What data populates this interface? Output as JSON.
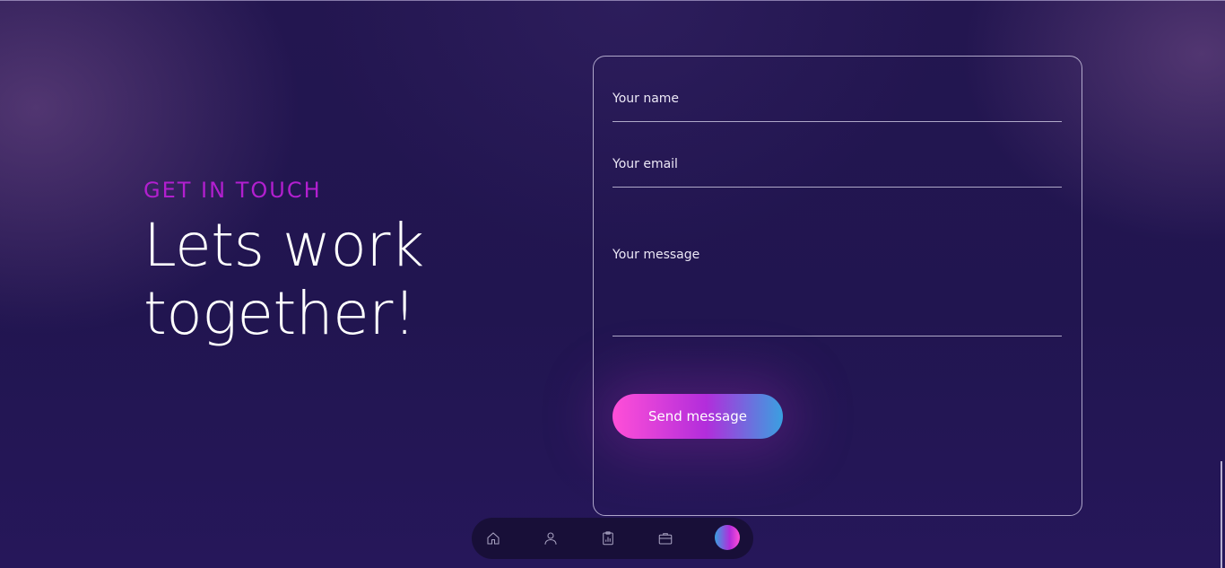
{
  "hero": {
    "eyebrow": "GET IN TOUCH",
    "headline_line1": "Lets work",
    "headline_line2": "together!"
  },
  "form": {
    "name_placeholder": "Your name",
    "email_placeholder": "Your email",
    "message_placeholder": "Your message",
    "send_label": "Send message"
  },
  "dock": {
    "items": [
      {
        "icon": "home-icon"
      },
      {
        "icon": "user-icon"
      },
      {
        "icon": "clipboard-chart-icon"
      },
      {
        "icon": "briefcase-icon"
      },
      {
        "icon": "contact-active-indicator"
      }
    ]
  },
  "colors": {
    "accent": "#b21fcf",
    "button_start": "#ff4fd8",
    "button_end": "#3aa0e0",
    "background": "#221551"
  }
}
